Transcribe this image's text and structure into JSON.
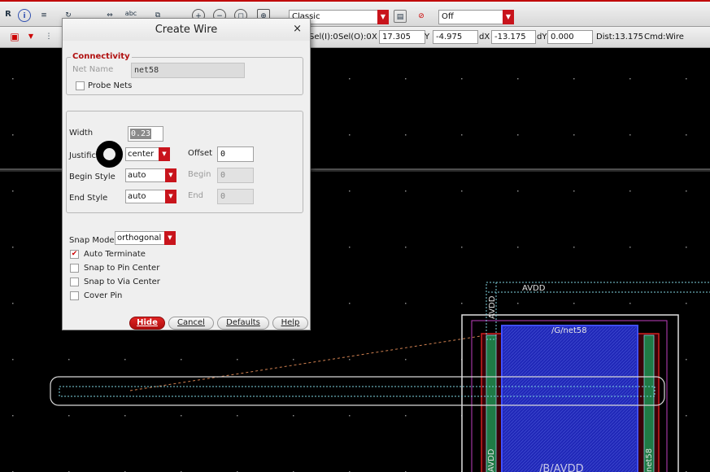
{
  "toolbar1": {
    "view_mode": "Classic",
    "option_value": "Off",
    "icons": [
      "layout-r-icon",
      "info-icon",
      "align-icon",
      "rotate-icon",
      "stretch-icon",
      "abc-label-icon",
      "copy-icon",
      "zoom-in-icon",
      "zoom-out-icon",
      "zoom-fit-icon",
      "zoom-select-icon",
      "palette-icon",
      "undo-icon"
    ],
    "label_icon_text": "abc"
  },
  "toolbar2": {
    "sel_i": "Sel(I):0",
    "sel_o": "Sel(O):0",
    "x_label": "X",
    "x_value": "17.305",
    "y_label": "Y",
    "y_value": "-4.975",
    "dx_label": "dX",
    "dx_value": "-13.175",
    "dy_label": "dY",
    "dy_value": "0.000",
    "dist": "Dist:13.175",
    "cmd": "Cmd:Wire"
  },
  "dialog": {
    "title": "Create Wire",
    "close": "×",
    "connectivity": {
      "label": "Connectivity",
      "net_name_label": "Net Name",
      "net_name_value": "net58",
      "probe_nets_label": "Probe Nets",
      "probe_nets_checked": false
    },
    "geometry": {
      "width_label": "Width",
      "width_value": "0.23",
      "justification_label": "Justifica",
      "justification_value": "center",
      "offset_label": "Offset",
      "offset_value": "0",
      "begin_style_label": "Begin Style",
      "begin_style_value": "auto",
      "begin_label": "Begin",
      "begin_value": "0",
      "end_style_label": "End Style",
      "end_style_value": "auto",
      "end_label": "End",
      "end_value": "0"
    },
    "snap": {
      "snap_mode_label": "Snap Mode",
      "snap_mode_value": "orthogonal",
      "auto_terminate_label": "Auto Terminate",
      "auto_terminate_checked": true,
      "snap_pin_label": "Snap to Pin Center",
      "snap_via_label": "Snap to Via Center",
      "cover_pin_label": "Cover Pin"
    },
    "buttons": {
      "hide": "Hide",
      "cancel": "Cancel",
      "defaults": "Defaults",
      "help": "Help"
    }
  },
  "layout_canvas": {
    "labels": {
      "avdd_top": "AVDD",
      "avdd_vertical": "AVDD",
      "g_net58": "/G/net58",
      "b_avdd": "/B/AVDD",
      "net58_vertical": "net58",
      "avdd_bottom": "AVDD"
    },
    "colors": {
      "background": "#000000",
      "grid_dot": "#7a7a7a",
      "wire_outline": "#c8c8c8",
      "metal_cyan": "#7fd4e0",
      "blue_fill": "#2028b8",
      "red_outline": "#d02020",
      "magenta_outline": "#c040c0",
      "green_contact": "#2aa05a"
    }
  }
}
